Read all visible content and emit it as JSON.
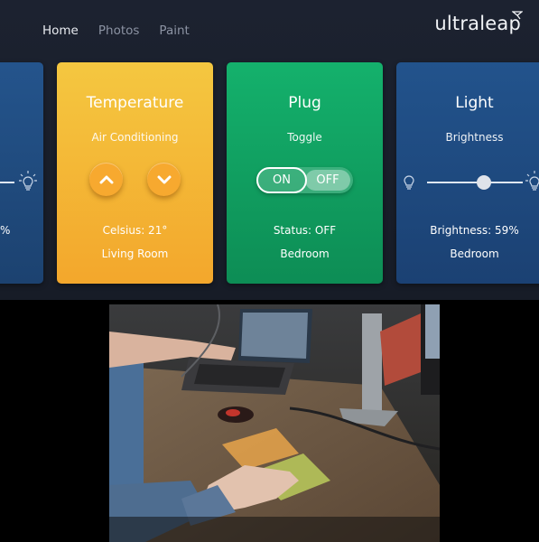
{
  "nav": {
    "items": [
      {
        "label": "Home",
        "active": true
      },
      {
        "label": "Photos",
        "active": false
      },
      {
        "label": "Paint",
        "active": false
      }
    ]
  },
  "brand": {
    "name": "ultraleap"
  },
  "cards": {
    "partial": {
      "value": "%"
    },
    "temperature": {
      "title": "Temperature",
      "subtitle": "Air Conditioning",
      "status": "Celsius: 21°",
      "room": "Living Room",
      "color": "#f3b534"
    },
    "plug": {
      "title": "Plug",
      "subtitle": "Toggle",
      "on_label": "ON",
      "off_label": "OFF",
      "status": "Status: OFF",
      "room": "Bedroom",
      "color": "#11a062"
    },
    "light": {
      "title": "Light",
      "subtitle": "Brightness",
      "status": "Brightness: 59%",
      "room": "Bedroom",
      "brightness": 0.59,
      "color": "#1f4a80"
    }
  },
  "icons": [
    "up-arrow-icon",
    "down-arrow-icon",
    "bulb-off-icon",
    "bulb-on-icon"
  ],
  "camera_feed": {
    "description_visible": false
  }
}
